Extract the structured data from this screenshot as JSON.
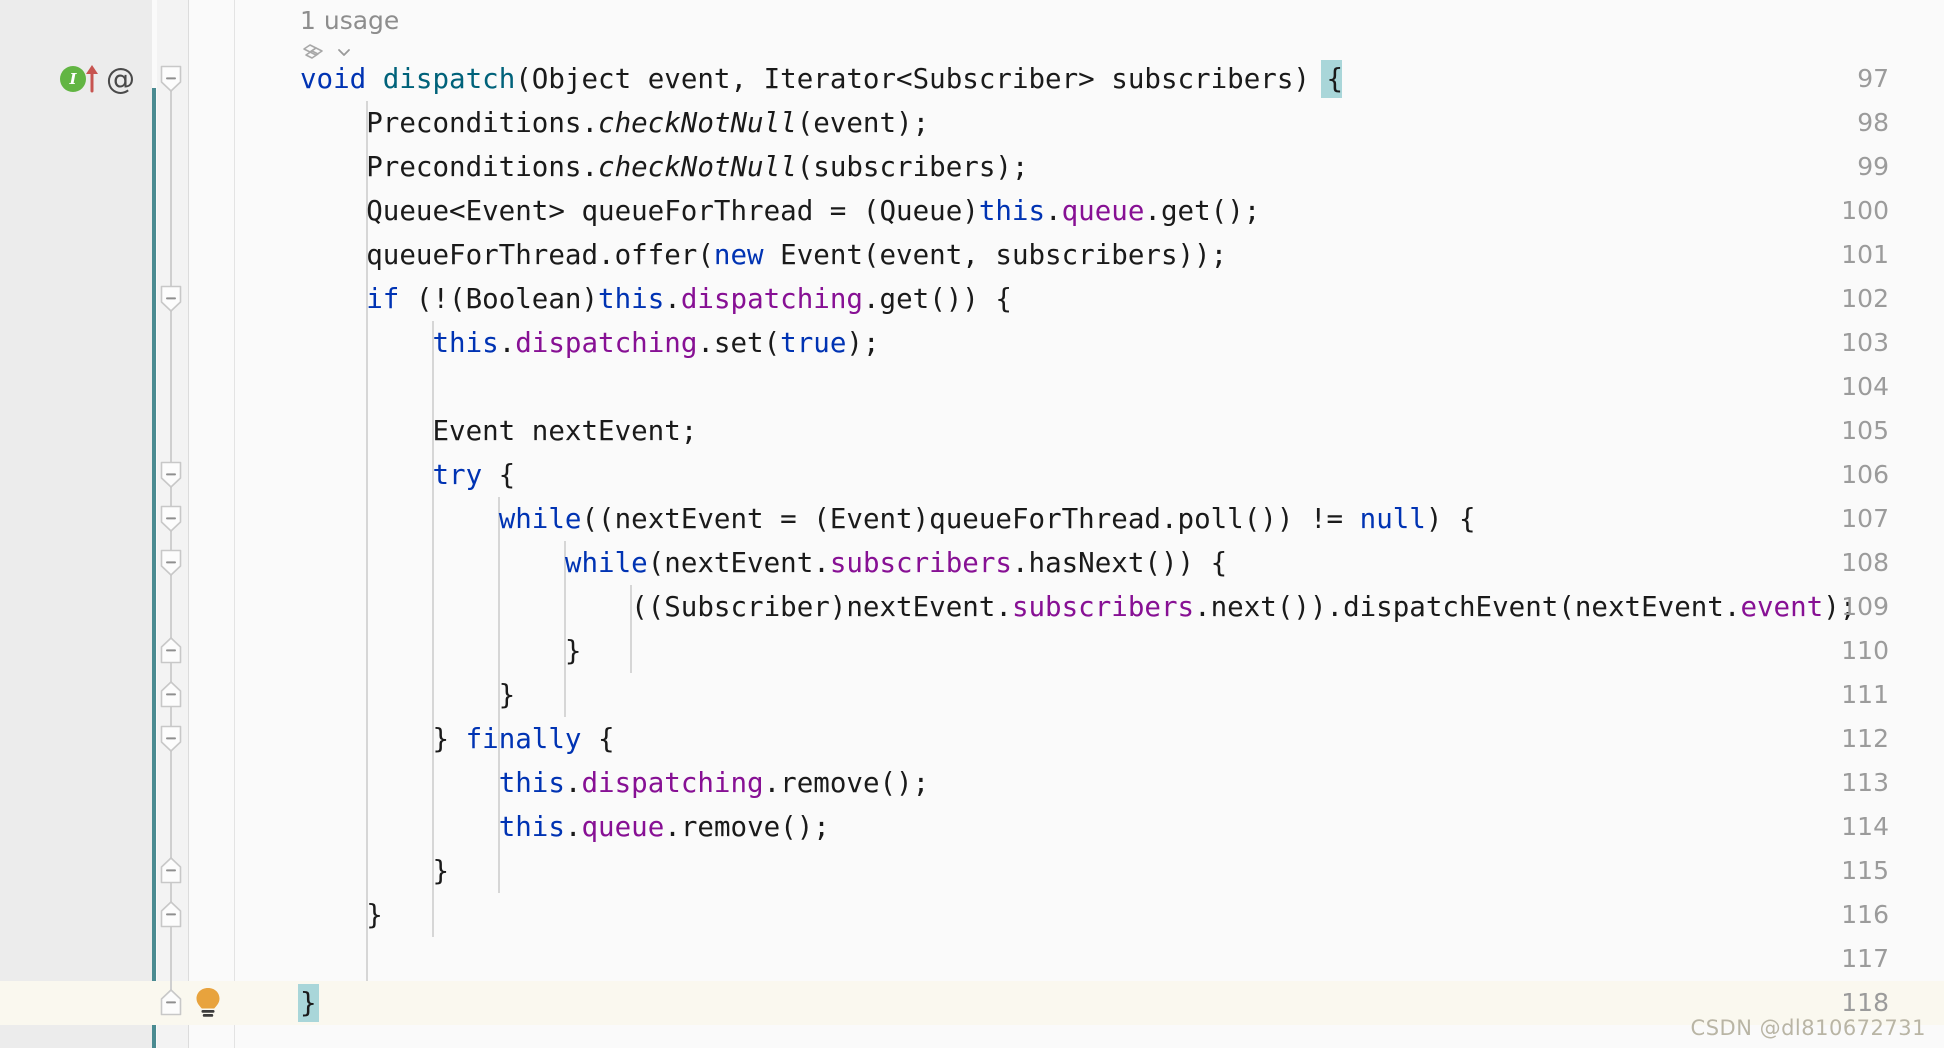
{
  "editor": {
    "app": "IntelliJ IDEA Java Editor",
    "language": "Java",
    "theme": "light",
    "colors": {
      "editor_background": "#fafafa",
      "gutter_background": "#ececec",
      "gutter_band_background": "#f3f3f3",
      "current_line_background": "#faf8ef",
      "change_marker": "#4a8b91",
      "keyword": "#0033b3",
      "field": "#871094",
      "static_method": "#00627a",
      "text": "#1a1a1a",
      "line_number": "#9b9b9b",
      "brace_match_highlight": "#a9d6d9",
      "indent_guide": "#d6d6d6",
      "inlay_hint": "#8d8d8d",
      "implement_badge": "#62b543",
      "bulb": "#e8a33d",
      "watermark": "#b9b5a5"
    }
  },
  "inlay_hints": {
    "usage_label": "1 usage",
    "icons": [
      {
        "name": "related-symbol-icon",
        "label": "related"
      },
      {
        "name": "chevron-down-icon",
        "label": "expand"
      }
    ]
  },
  "gutter": {
    "first_line": 97,
    "last_line": 118,
    "line_numbers": [
      97,
      98,
      99,
      100,
      101,
      102,
      103,
      104,
      105,
      106,
      107,
      108,
      109,
      110,
      111,
      112,
      113,
      114,
      115,
      116,
      117,
      118
    ],
    "icons": [
      {
        "name": "implementing-method-icon",
        "line": 97,
        "glyph": "I",
        "tooltip": "Implements method"
      },
      {
        "name": "overriding-arrow-icon",
        "line": 97,
        "tooltip": "Overrides"
      },
      {
        "name": "annotation-icon",
        "line": 97,
        "glyph": "@",
        "tooltip": "Annotation"
      },
      {
        "name": "intention-bulb-icon",
        "line": 118,
        "tooltip": "Show context actions"
      }
    ],
    "fold_markers": [
      {
        "line": 97,
        "direction": "down"
      },
      {
        "line": 102,
        "direction": "down"
      },
      {
        "line": 106,
        "direction": "down"
      },
      {
        "line": 107,
        "direction": "down"
      },
      {
        "line": 108,
        "direction": "down"
      },
      {
        "line": 110,
        "direction": "up"
      },
      {
        "line": 111,
        "direction": "up"
      },
      {
        "line": 112,
        "direction": "down"
      },
      {
        "line": 115,
        "direction": "up"
      },
      {
        "line": 116,
        "direction": "up"
      },
      {
        "line": 118,
        "direction": "up"
      }
    ]
  },
  "code": {
    "lines": [
      {
        "number": 97,
        "indent": 0,
        "tokens": [
          {
            "t": "void",
            "c": "kw"
          },
          {
            "t": " ",
            "c": "plain"
          },
          {
            "t": "dispatch",
            "c": "meth"
          },
          {
            "t": "(Object event, Iterator<Subscriber> subscribers) ",
            "c": "plain"
          },
          {
            "t": "{",
            "c": "plain",
            "highlight": true
          }
        ]
      },
      {
        "number": 98,
        "indent": 1,
        "tokens": [
          {
            "t": "    Preconditions.",
            "c": "plain"
          },
          {
            "t": "checkNotNull",
            "c": "stat"
          },
          {
            "t": "(event);",
            "c": "plain"
          }
        ]
      },
      {
        "number": 99,
        "indent": 1,
        "tokens": [
          {
            "t": "    Preconditions.",
            "c": "plain"
          },
          {
            "t": "checkNotNull",
            "c": "stat"
          },
          {
            "t": "(subscribers);",
            "c": "plain"
          }
        ]
      },
      {
        "number": 100,
        "indent": 1,
        "tokens": [
          {
            "t": "    Queue<Event> queueForThread = (Queue)",
            "c": "plain"
          },
          {
            "t": "this",
            "c": "kw"
          },
          {
            "t": ".",
            "c": "plain"
          },
          {
            "t": "queue",
            "c": "fld"
          },
          {
            "t": ".get();",
            "c": "plain"
          }
        ]
      },
      {
        "number": 101,
        "indent": 1,
        "tokens": [
          {
            "t": "    queueForThread.offer(",
            "c": "plain"
          },
          {
            "t": "new",
            "c": "kw"
          },
          {
            "t": " Event(event, subscribers));",
            "c": "plain"
          }
        ]
      },
      {
        "number": 102,
        "indent": 1,
        "tokens": [
          {
            "t": "    ",
            "c": "plain"
          },
          {
            "t": "if",
            "c": "kw"
          },
          {
            "t": " (!(Boolean)",
            "c": "plain"
          },
          {
            "t": "this",
            "c": "kw"
          },
          {
            "t": ".",
            "c": "plain"
          },
          {
            "t": "dispatching",
            "c": "fld"
          },
          {
            "t": ".get()) {",
            "c": "plain"
          }
        ]
      },
      {
        "number": 103,
        "indent": 2,
        "tokens": [
          {
            "t": "        ",
            "c": "plain"
          },
          {
            "t": "this",
            "c": "kw"
          },
          {
            "t": ".",
            "c": "plain"
          },
          {
            "t": "dispatching",
            "c": "fld"
          },
          {
            "t": ".set(",
            "c": "plain"
          },
          {
            "t": "true",
            "c": "kw"
          },
          {
            "t": ");",
            "c": "plain"
          }
        ]
      },
      {
        "number": 104,
        "indent": 2,
        "tokens": []
      },
      {
        "number": 105,
        "indent": 2,
        "tokens": [
          {
            "t": "        Event nextEvent;",
            "c": "plain"
          }
        ]
      },
      {
        "number": 106,
        "indent": 2,
        "tokens": [
          {
            "t": "        ",
            "c": "plain"
          },
          {
            "t": "try",
            "c": "kw"
          },
          {
            "t": " {",
            "c": "plain"
          }
        ]
      },
      {
        "number": 107,
        "indent": 3,
        "tokens": [
          {
            "t": "            ",
            "c": "plain"
          },
          {
            "t": "while",
            "c": "kw"
          },
          {
            "t": "((nextEvent = (Event)queueForThread.poll()) != ",
            "c": "plain"
          },
          {
            "t": "null",
            "c": "kw"
          },
          {
            "t": ") {",
            "c": "plain"
          }
        ]
      },
      {
        "number": 108,
        "indent": 4,
        "tokens": [
          {
            "t": "                ",
            "c": "plain"
          },
          {
            "t": "while",
            "c": "kw"
          },
          {
            "t": "(nextEvent.",
            "c": "plain"
          },
          {
            "t": "subscribers",
            "c": "fld"
          },
          {
            "t": ".hasNext()) {",
            "c": "plain"
          }
        ]
      },
      {
        "number": 109,
        "indent": 5,
        "tokens": [
          {
            "t": "                    ((Subscriber)nextEvent.",
            "c": "plain"
          },
          {
            "t": "subscribers",
            "c": "fld"
          },
          {
            "t": ".next()).dispatchEvent(nextEvent.",
            "c": "plain"
          },
          {
            "t": "event",
            "c": "fld"
          },
          {
            "t": ");",
            "c": "plain"
          }
        ]
      },
      {
        "number": 110,
        "indent": 4,
        "tokens": [
          {
            "t": "                }",
            "c": "plain"
          }
        ]
      },
      {
        "number": 111,
        "indent": 3,
        "tokens": [
          {
            "t": "            }",
            "c": "plain"
          }
        ]
      },
      {
        "number": 112,
        "indent": 2,
        "tokens": [
          {
            "t": "        } ",
            "c": "plain"
          },
          {
            "t": "finally",
            "c": "kw"
          },
          {
            "t": " {",
            "c": "plain"
          }
        ]
      },
      {
        "number": 113,
        "indent": 3,
        "tokens": [
          {
            "t": "            ",
            "c": "plain"
          },
          {
            "t": "this",
            "c": "kw"
          },
          {
            "t": ".",
            "c": "plain"
          },
          {
            "t": "dispatching",
            "c": "fld"
          },
          {
            "t": ".remove();",
            "c": "plain"
          }
        ]
      },
      {
        "number": 114,
        "indent": 3,
        "tokens": [
          {
            "t": "            ",
            "c": "plain"
          },
          {
            "t": "this",
            "c": "kw"
          },
          {
            "t": ".",
            "c": "plain"
          },
          {
            "t": "queue",
            "c": "fld"
          },
          {
            "t": ".remove();",
            "c": "plain"
          }
        ]
      },
      {
        "number": 115,
        "indent": 2,
        "tokens": [
          {
            "t": "        }",
            "c": "plain"
          }
        ]
      },
      {
        "number": 116,
        "indent": 1,
        "tokens": [
          {
            "t": "    }",
            "c": "plain"
          }
        ]
      },
      {
        "number": 117,
        "indent": 1,
        "tokens": []
      },
      {
        "number": 118,
        "indent": 0,
        "current": true,
        "tokens": [
          {
            "t": "}",
            "c": "plain",
            "highlight": true
          }
        ]
      }
    ]
  },
  "watermark": {
    "text": "CSDN @dl810672731"
  }
}
